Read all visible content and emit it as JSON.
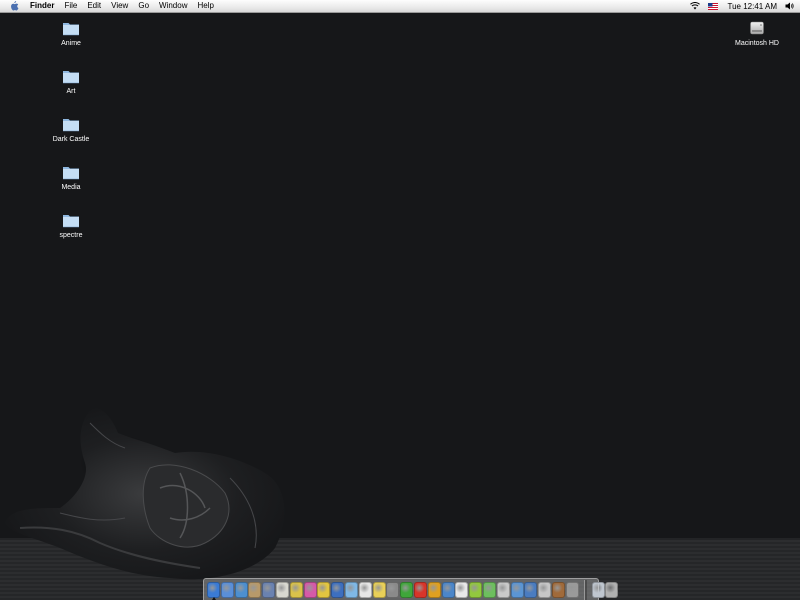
{
  "menubar": {
    "apple_icon": "apple-icon",
    "app_name": "Finder",
    "menus": [
      "File",
      "Edit",
      "View",
      "Go",
      "Window",
      "Help"
    ],
    "clock": "Tue 12:41 AM",
    "status_icons": [
      "wifi-icon",
      "us-flag-icon",
      "volume-icon"
    ]
  },
  "desktop": {
    "folders": [
      {
        "label": "Anime",
        "icon": "folder-icon"
      },
      {
        "label": "Art",
        "icon": "folder-icon"
      },
      {
        "label": "Dark Castle",
        "icon": "folder-icon"
      },
      {
        "label": "Media",
        "icon": "folder-icon"
      },
      {
        "label": "spectre",
        "icon": "folder-icon"
      }
    ],
    "drive": {
      "label": "Macintosh HD",
      "icon": "hard-drive-icon"
    }
  },
  "dock": {
    "apps": [
      {
        "icon": "finder-icon",
        "color": "#3a7bd5",
        "running": true
      },
      {
        "icon": "mail-icon",
        "color": "#5a8fd8"
      },
      {
        "icon": "safari-icon",
        "color": "#4d8fcf"
      },
      {
        "icon": "text-editor-icon",
        "color": "#b89a6a"
      },
      {
        "icon": "address-book-icon",
        "color": "#6a82b0"
      },
      {
        "icon": "image-viewer-icon",
        "color": "#d8d8d0"
      },
      {
        "icon": "notes-icon",
        "color": "#d9c24a"
      },
      {
        "icon": "pinwheel-icon",
        "color": "#d65aa8"
      },
      {
        "icon": "ichat-icon",
        "color": "#e2c640"
      },
      {
        "icon": "word-icon",
        "color": "#3d6fbf"
      },
      {
        "icon": "itunes-icon",
        "color": "#7fb8e6"
      },
      {
        "icon": "document-icon",
        "color": "#e6e6e6"
      },
      {
        "icon": "sun-icon",
        "color": "#e9d058"
      },
      {
        "icon": "clapper-icon",
        "color": "#8a8a8a"
      },
      {
        "icon": "green-swirl-icon",
        "color": "#3fa63a"
      },
      {
        "icon": "red-circle-icon",
        "color": "#d8352a"
      },
      {
        "icon": "yellow-flash-icon",
        "color": "#e0a020"
      },
      {
        "icon": "globe-icon",
        "color": "#4b86c9"
      },
      {
        "icon": "ipod-icon",
        "color": "#e8e8e8"
      },
      {
        "icon": "green-square-icon",
        "color": "#92c83e"
      },
      {
        "icon": "spiral-icon",
        "color": "#6dbf5e"
      },
      {
        "icon": "play-icon",
        "color": "#c9c9c9"
      },
      {
        "icon": "compass-icon",
        "color": "#5b95d3"
      },
      {
        "icon": "xcode-icon",
        "color": "#4a7cc0"
      },
      {
        "icon": "dictionary-icon",
        "color": "#c7c7c7"
      },
      {
        "icon": "tools-icon",
        "color": "#a06a3a"
      },
      {
        "icon": "system-preferences-icon",
        "color": "#9a9a9a"
      }
    ],
    "others": [
      {
        "icon": "download-stack-icon",
        "color": "#bfc6cf"
      },
      {
        "icon": "trash-icon",
        "color": "#b0b0b0"
      }
    ]
  }
}
